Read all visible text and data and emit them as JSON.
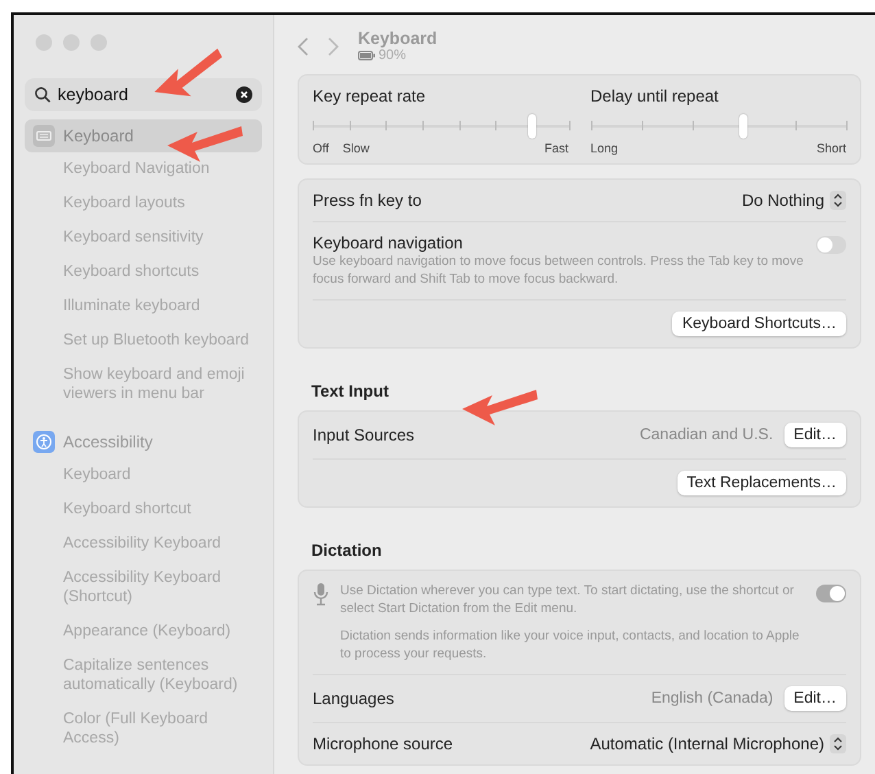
{
  "search": {
    "value": "keyboard"
  },
  "sidebar": {
    "groups": [
      {
        "label": "Keyboard",
        "selected": true,
        "children": [
          {
            "label": "Keyboard Navigation"
          },
          {
            "label": "Keyboard layouts"
          },
          {
            "label": "Keyboard sensitivity"
          },
          {
            "label": "Keyboard shortcuts"
          },
          {
            "label": "Illuminate keyboard"
          },
          {
            "label": "Set up Bluetooth keyboard"
          },
          {
            "label": "Show keyboard and emoji viewers in menu bar"
          }
        ]
      },
      {
        "label": "Accessibility",
        "selected": false,
        "children": [
          {
            "label": "Keyboard"
          },
          {
            "label": "Keyboard shortcut"
          },
          {
            "label": "Accessibility Keyboard"
          },
          {
            "label": "Accessibility Keyboard (Shortcut)"
          },
          {
            "label": "Appearance (Keyboard)"
          },
          {
            "label": "Capitalize sentences automatically (Keyboard)"
          },
          {
            "label": "Color (Full Keyboard Access)"
          }
        ]
      }
    ]
  },
  "header": {
    "title": "Keyboard",
    "battery": "90%"
  },
  "sliders": [
    {
      "label": "Key repeat rate",
      "level": 0.857,
      "marks": [
        "Off",
        "Slow",
        "Fast"
      ]
    },
    {
      "label": "Delay until repeat",
      "level": 0.6,
      "marks": [
        "Long",
        "Short"
      ]
    }
  ],
  "fn_row": {
    "label": "Press fn key to",
    "value": "Do Nothing"
  },
  "keyboard_navigation": {
    "label": "Keyboard navigation",
    "description": "Use keyboard navigation to move focus between controls. Press the Tab key to move focus forward and Shift Tab to move focus backward.",
    "on": false
  },
  "shortcuts_button": "Keyboard Shortcuts…",
  "text_input": {
    "heading": "Text Input",
    "sources_label": "Input Sources",
    "sources_value": "Canadian and U.S.",
    "edit_button": "Edit…",
    "replacements_button": "Text Replacements…"
  },
  "dictation": {
    "heading": "Dictation",
    "description": "Use Dictation wherever you can type text. To start dictating, use the shortcut or select Start Dictation from the Edit menu.",
    "privacy": "Dictation sends information like your voice input, contacts, and location to Apple to process your requests.",
    "on": true,
    "languages_label": "Languages",
    "languages_value": "English (Canada)",
    "edit_button": "Edit…",
    "mic_label": "Microphone source",
    "mic_value": "Automatic (Internal Microphone)"
  }
}
